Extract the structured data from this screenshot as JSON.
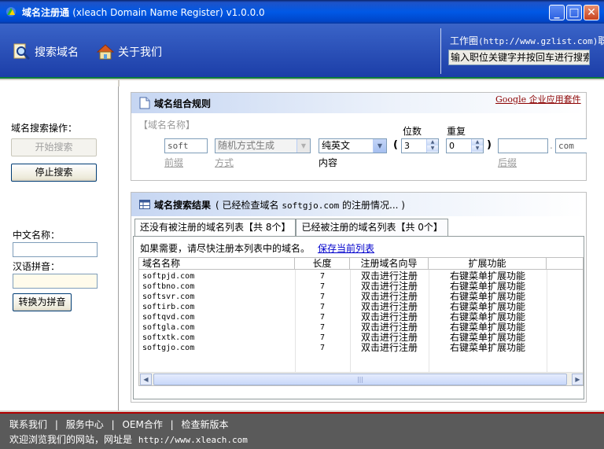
{
  "window": {
    "title": "域名注册通",
    "subtitle": "(xleach Domain Name Register) v1.0.0.0",
    "min": "_",
    "max": "□",
    "close": "✕"
  },
  "nav": {
    "search_label": "搜索域名",
    "about_label": "关于我们",
    "work_label": "工作圈",
    "work_url": "(http://www.gzlist.com)",
    "work_suffix": "职位",
    "ticker": "输入职位关键字并按回车进行搜索"
  },
  "left": {
    "ops_label": "域名搜索操作：",
    "start_button": "开始搜索",
    "stop_button": "停止搜索",
    "cn_name_label": "中文名称：",
    "cn_name_value": "",
    "pinyin_label": "汉语拼音：",
    "pinyin_value": "",
    "convert_button": "转换为拼音"
  },
  "rules": {
    "title": "域名组合规则",
    "google_link": "Google 企业应用套件",
    "domain_name_label": "【域名名称】",
    "prefix_value": "soft",
    "mode_value": "随机方式生成",
    "content_value": "纯英文",
    "digits_label": "位数",
    "digits_value": "3",
    "repeat_label": "重复",
    "repeat_value": "0",
    "suffix_value": "",
    "tld_value": "com",
    "prefix_label": "前缀",
    "mode_label": "方式",
    "content_label": "内容",
    "suffix_label": "后缀",
    "open_paren": "(",
    "close_paren": ")",
    "dot": "."
  },
  "results": {
    "title": "域名搜索结果",
    "status_prefix": "( 已经检查域名",
    "status_domain": "softgjo.com",
    "status_suffix": "的注册情况... )",
    "tab_unregistered": "还没有被注册的域名列表【共 8个】",
    "tab_registered": "已经被注册的域名列表【共 0个】",
    "hint": "如果需要，请尽快注册本列表中的域名。",
    "save_link": "保存当前列表",
    "columns": [
      "域名名称",
      "长度",
      "注册域名向导",
      "扩展功能"
    ],
    "rows": [
      {
        "domain": "softpjd.com",
        "length": "7",
        "wizard": "双击进行注册",
        "ext": "右键菜单扩展功能"
      },
      {
        "domain": "softbno.com",
        "length": "7",
        "wizard": "双击进行注册",
        "ext": "右键菜单扩展功能"
      },
      {
        "domain": "softsvr.com",
        "length": "7",
        "wizard": "双击进行注册",
        "ext": "右键菜单扩展功能"
      },
      {
        "domain": "softirb.com",
        "length": "7",
        "wizard": "双击进行注册",
        "ext": "右键菜单扩展功能"
      },
      {
        "domain": "softqvd.com",
        "length": "7",
        "wizard": "双击进行注册",
        "ext": "右键菜单扩展功能"
      },
      {
        "domain": "softgla.com",
        "length": "7",
        "wizard": "双击进行注册",
        "ext": "右键菜单扩展功能"
      },
      {
        "domain": "softxtk.com",
        "length": "7",
        "wizard": "双击进行注册",
        "ext": "右键菜单扩展功能"
      },
      {
        "domain": "softgjo.com",
        "length": "7",
        "wizard": "双击进行注册",
        "ext": "右键菜单扩展功能"
      }
    ]
  },
  "footer": {
    "contact": "联系我们",
    "service": "服务中心",
    "oem": "OEM合作",
    "update": "检查新版本",
    "sep": "|",
    "welcome": "欢迎浏览我们的网站，网址是",
    "site_url": "http://www.xleach.com"
  },
  "colors": {
    "titlebar": "#0058e6",
    "banner": "#2a50b8",
    "footer": "#5a5a5a",
    "accent_red": "#b00000"
  },
  "icons": [
    "app-icon",
    "magnifier-icon",
    "house-icon",
    "document-icon",
    "grid-icon",
    "chevron-down-icon",
    "spin-up-icon",
    "spin-down-icon",
    "scroll-left-icon",
    "scroll-right-icon"
  ]
}
